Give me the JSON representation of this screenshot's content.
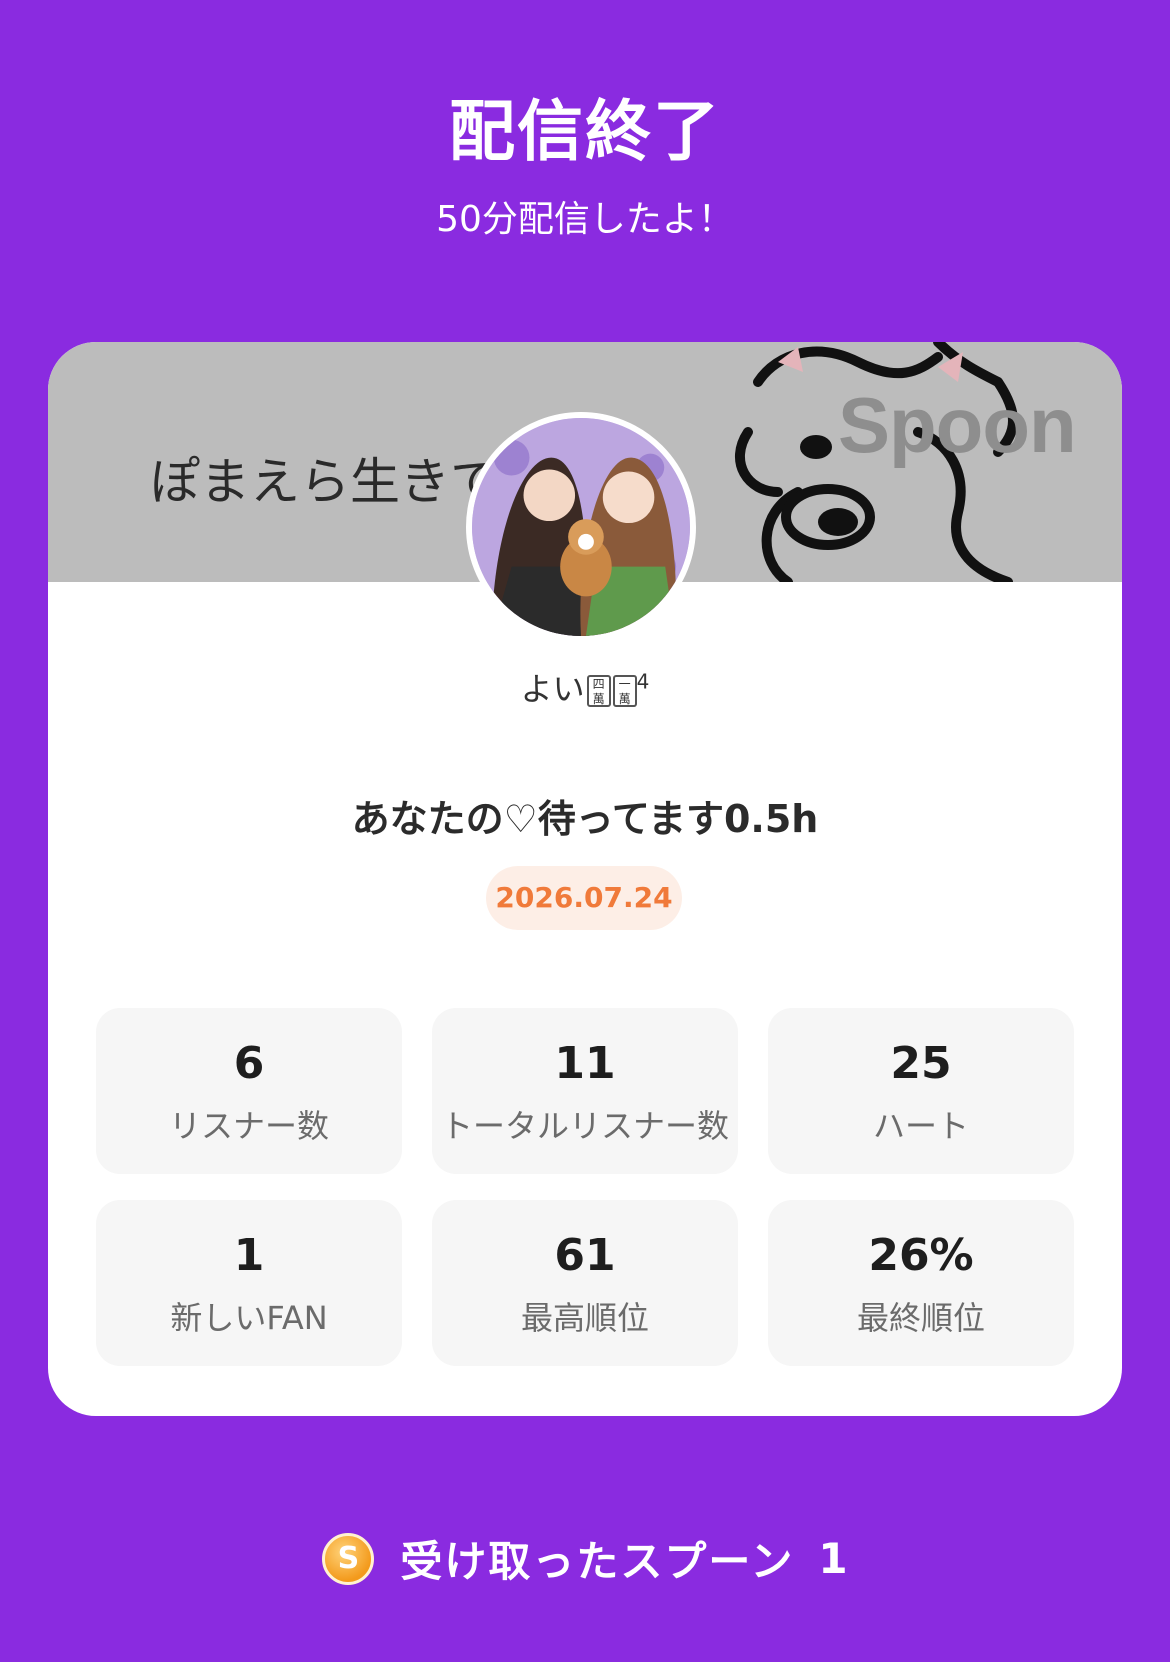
{
  "header": {
    "title": "配信終了",
    "subtitle": "50分配信したよ！"
  },
  "card": {
    "banner_text": "ぽまえら生きて",
    "banner_logo": "Spoon",
    "username": "よい",
    "username_tiles": [
      "四\n萬",
      "一\n萬"
    ],
    "username_sup": "4",
    "live_title": "あなたの♡待ってます0.5h",
    "date": "2026.07.24",
    "stats": [
      {
        "value": "6",
        "label": "リスナー数"
      },
      {
        "value": "11",
        "label": "トータルリスナー数"
      },
      {
        "value": "25",
        "label": "ハート"
      },
      {
        "value": "1",
        "label": "新しいFAN"
      },
      {
        "value": "61",
        "label": "最高順位"
      },
      {
        "value": "26%",
        "label": "最終順位"
      }
    ]
  },
  "footer": {
    "coin_icon_letter": "S",
    "spoon_label": "受け取ったスプーン",
    "spoon_count": "1"
  },
  "colors": {
    "background": "#8a2be0",
    "date_text": "#f07a3a",
    "date_bg": "#fdeee6"
  }
}
